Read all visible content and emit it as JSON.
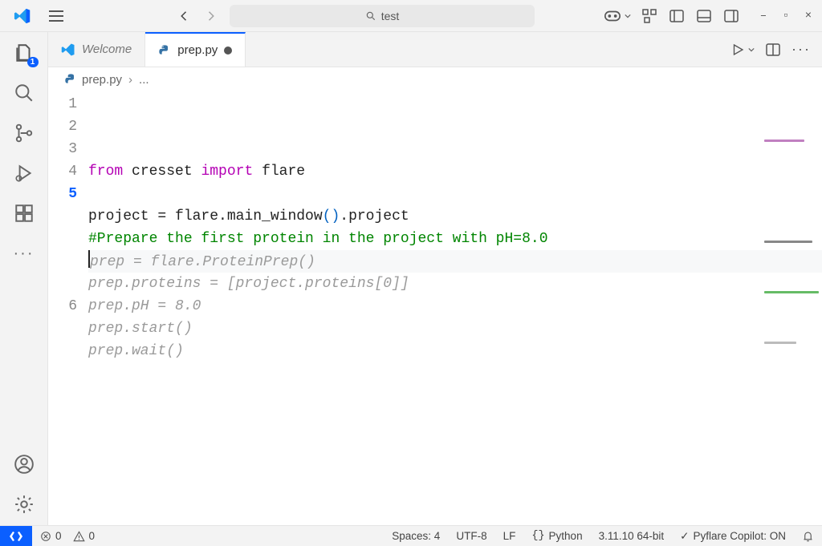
{
  "titlebar": {
    "search_placeholder": "test",
    "nav_back_icon": "arrow-left",
    "nav_fwd_icon": "arrow-right"
  },
  "activitybar": {
    "explorer_badge": "1"
  },
  "tabs": [
    {
      "label": "Welcome",
      "icon": "vscode",
      "active": false,
      "dirty": false
    },
    {
      "label": "prep.py",
      "icon": "python",
      "active": true,
      "dirty": true
    }
  ],
  "breadcrumb": {
    "file_icon": "python",
    "file": "prep.py",
    "more": "..."
  },
  "editor": {
    "active_line": 5,
    "lines": [
      {
        "n": 1,
        "type": "code",
        "tokens": [
          {
            "t": "from ",
            "c": "kw-from"
          },
          {
            "t": "cresset ",
            "c": "ident"
          },
          {
            "t": "import ",
            "c": "kw-import"
          },
          {
            "t": "flare",
            "c": "ident"
          }
        ]
      },
      {
        "n": 2,
        "type": "blank",
        "text": ""
      },
      {
        "n": 3,
        "type": "code",
        "tokens": [
          {
            "t": "project = flare.main_window",
            "c": "ident"
          },
          {
            "t": "()",
            "c": "paren"
          },
          {
            "t": ".project",
            "c": "ident"
          }
        ]
      },
      {
        "n": 4,
        "type": "comment",
        "text": "#Prepare the first protein in the project with pH=8.0"
      },
      {
        "n": 5,
        "type": "ghost-first",
        "text": "prep = flare.ProteinPrep()"
      },
      {
        "n": null,
        "type": "ghost",
        "text": "prep.proteins = [project.proteins[0]]"
      },
      {
        "n": null,
        "type": "ghost",
        "text": "prep.pH = 8.0"
      },
      {
        "n": null,
        "type": "ghost",
        "text": "prep.start()"
      },
      {
        "n": null,
        "type": "ghost",
        "text": "prep.wait()"
      },
      {
        "n": 6,
        "type": "blank",
        "text": ""
      }
    ]
  },
  "statusbar": {
    "errors": "0",
    "warnings": "0",
    "spaces": "Spaces: 4",
    "encoding": "UTF-8",
    "eol": "LF",
    "lang": "Python",
    "interp": "3.11.10 64-bit",
    "copilot": "Pyflare Copilot: ON"
  },
  "colors": {
    "accent": "#0b5fff"
  }
}
